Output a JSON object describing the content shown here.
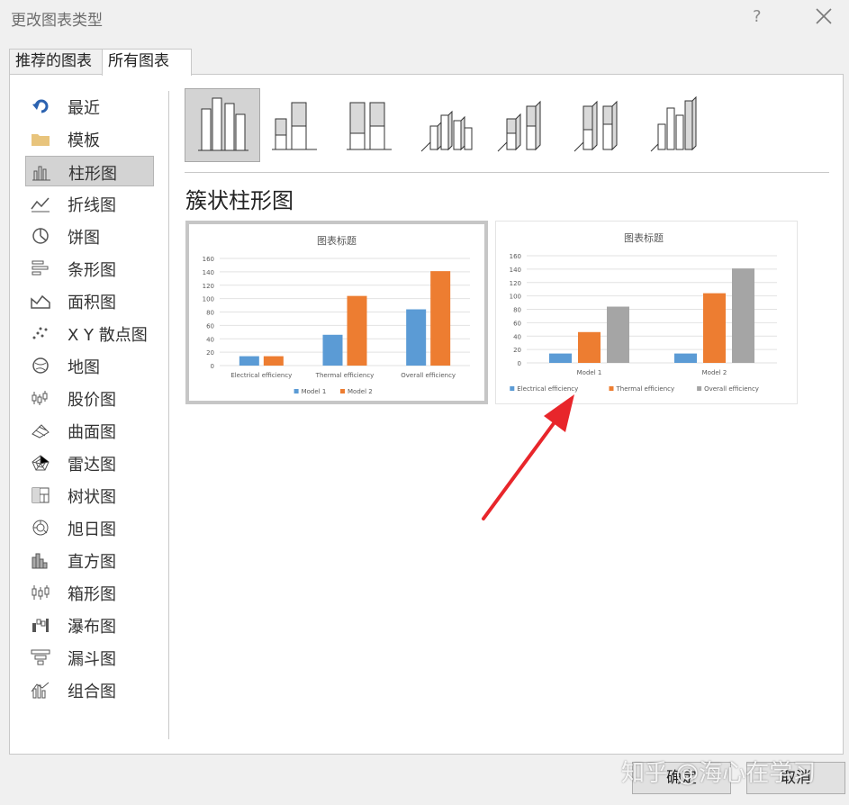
{
  "dialog": {
    "title": "更改图表类型",
    "help_label": "?"
  },
  "tabs": [
    {
      "label": "推荐的图表"
    },
    {
      "label": "所有图表"
    }
  ],
  "sidebar": {
    "items": [
      {
        "label": "最近",
        "icon": "recent-icon"
      },
      {
        "label": "模板",
        "icon": "folder-icon"
      },
      {
        "label": "柱形图",
        "icon": "column-chart-icon",
        "selected": true
      },
      {
        "label": "折线图",
        "icon": "line-chart-icon"
      },
      {
        "label": "饼图",
        "icon": "pie-chart-icon"
      },
      {
        "label": "条形图",
        "icon": "bar-chart-icon"
      },
      {
        "label": "面积图",
        "icon": "area-chart-icon"
      },
      {
        "label": "X Y 散点图",
        "icon": "scatter-chart-icon"
      },
      {
        "label": "地图",
        "icon": "map-chart-icon"
      },
      {
        "label": "股价图",
        "icon": "stock-chart-icon"
      },
      {
        "label": "曲面图",
        "icon": "surface-chart-icon"
      },
      {
        "label": "雷达图",
        "icon": "radar-chart-icon"
      },
      {
        "label": "树状图",
        "icon": "treemap-chart-icon"
      },
      {
        "label": "旭日图",
        "icon": "sunburst-chart-icon"
      },
      {
        "label": "直方图",
        "icon": "histogram-chart-icon"
      },
      {
        "label": "箱形图",
        "icon": "box-whisker-chart-icon"
      },
      {
        "label": "瀑布图",
        "icon": "waterfall-chart-icon"
      },
      {
        "label": "漏斗图",
        "icon": "funnel-chart-icon"
      },
      {
        "label": "组合图",
        "icon": "combo-chart-icon"
      }
    ]
  },
  "subtypes": [
    {
      "icon": "clustered-column-icon",
      "selected": true
    },
    {
      "icon": "stacked-column-icon"
    },
    {
      "icon": "100-stacked-column-icon"
    },
    {
      "icon": "3d-clustered-column-icon"
    },
    {
      "icon": "3d-stacked-column-icon"
    },
    {
      "icon": "3d-100-stacked-column-icon"
    },
    {
      "icon": "3d-column-icon"
    }
  ],
  "subtype_title": "簇状柱形图",
  "colors": {
    "series1": "#5b9bd5",
    "series2": "#ed7d31",
    "series3": "#a5a5a5",
    "arrow": "#e8262b"
  },
  "chart_data": [
    {
      "type": "bar",
      "title": "图表标题",
      "categories": [
        "Electrical efficiency",
        "Thermal efficiency",
        "Overall efficiency"
      ],
      "series": [
        {
          "name": "Model 1",
          "values": [
            14,
            46,
            84
          ]
        },
        {
          "name": "Model 2",
          "values": [
            14,
            104,
            141
          ]
        }
      ],
      "ylim": [
        0,
        160
      ],
      "yticks": [
        "0",
        "20",
        "40",
        "60",
        "80",
        "100",
        "120",
        "140",
        "160"
      ],
      "grid": true,
      "legend": "bottom"
    },
    {
      "type": "bar",
      "title": "图表标题",
      "categories": [
        "Model 1",
        "Model 2"
      ],
      "series": [
        {
          "name": "Electrical efficiency",
          "values": [
            14,
            14
          ]
        },
        {
          "name": "Thermal efficiency",
          "values": [
            46,
            104
          ]
        },
        {
          "name": "Overall efficiency",
          "values": [
            84,
            141
          ]
        }
      ],
      "ylim": [
        0,
        160
      ],
      "yticks": [
        "0",
        "20",
        "40",
        "60",
        "80",
        "100",
        "120",
        "140",
        "160"
      ],
      "grid": true,
      "legend": "bottom"
    }
  ],
  "buttons": {
    "ok": "确定",
    "cancel": "取消"
  },
  "watermark": "知乎 @海心在学习"
}
